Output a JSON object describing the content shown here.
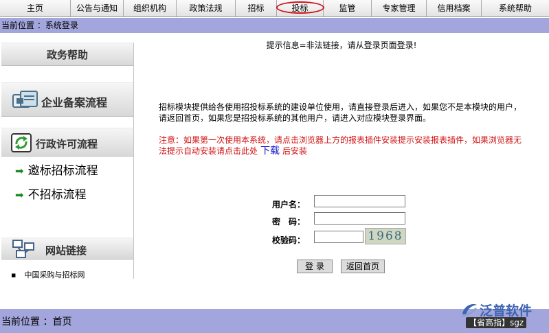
{
  "nav": {
    "items": [
      {
        "label": "主页"
      },
      {
        "label": "公告与通知"
      },
      {
        "label": "组织机构"
      },
      {
        "label": "政策法规"
      },
      {
        "label": "招标"
      },
      {
        "label": "投标"
      },
      {
        "label": "监管"
      },
      {
        "label": "专家管理"
      },
      {
        "label": "信用档案"
      },
      {
        "label": "系统帮助"
      }
    ],
    "active": "投标"
  },
  "crumb": {
    "text": "当前位置 ：系统登录"
  },
  "sidebar": {
    "title": "政务帮助",
    "section1": "企业备案流程",
    "section2": "行政许可流程",
    "links": [
      "邀标招标流程",
      "不招标流程"
    ],
    "section3": "网站链接",
    "site_link": "中国采购与招标网"
  },
  "main": {
    "message": "提示信息=非法链接，请从登录页面登录!",
    "info": "招标模块提供给各使用招投标系统的建设单位使用，请直接登录后进入，如果您不是本模块的用户，请返回首页，如果您是招投标系统的其他用户，请进入对应模块登录界面。",
    "notice_before": "注意：如果第一次使用本系统，请点击浏览器上方的报表插件安装提示安装报表插件，如果浏览器无法提示自动安装请点击此处",
    "notice_link": "下载",
    "notice_after": "后安装"
  },
  "form": {
    "username_label": "用户名：",
    "password_label": "密　码：",
    "captcha_label": "校验码：",
    "username_value": "",
    "password_value": "",
    "captcha_value": "",
    "captcha_image_text": "1968",
    "login_button": "登 录",
    "home_button": "返回首页"
  },
  "bottom": {
    "crumb": "当前位置 ：首页",
    "watermark": "泛普软件",
    "pill": "【省高指】sgz"
  },
  "colors": {
    "bar": "#a3a6dc",
    "active_ring": "#d0121b",
    "notice": "#d21010",
    "link": "#1515c8"
  }
}
